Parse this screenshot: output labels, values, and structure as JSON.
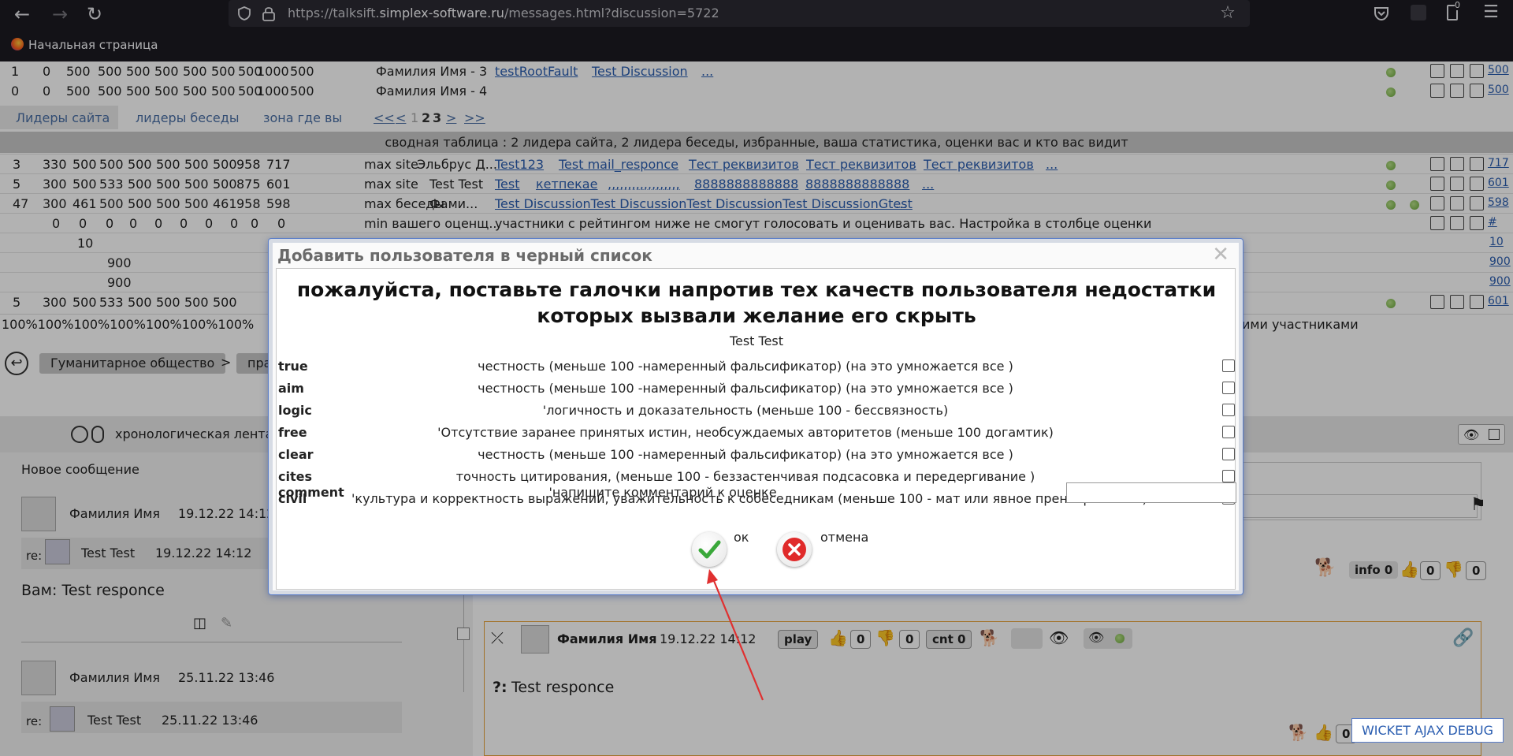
{
  "browser": {
    "url_prefix": "https://talksift.",
    "url_domain": "simplex-software.ru",
    "url_path": "/messages.html?discussion=5722",
    "bookmark": "Начальная страница",
    "downloads_badge": "0"
  },
  "table_top": [
    {
      "nums": [
        "1",
        "0",
        "500",
        "500",
        "500",
        "500",
        "500",
        "500",
        "500",
        "1000",
        "500"
      ],
      "name": "Фамилия Имя - 3",
      "links": [
        "testRootFault",
        "Test Discussion",
        "..."
      ],
      "score": "500"
    },
    {
      "nums": [
        "0",
        "0",
        "500",
        "500",
        "500",
        "500",
        "500",
        "500",
        "500",
        "1000",
        "500"
      ],
      "name": "Фамилия Имя - 4",
      "links": [],
      "score": "500"
    }
  ],
  "tabs": {
    "site_leaders": "Лидеры сайта",
    "chat_leaders": "лидеры беседы",
    "zone": "зона где вы"
  },
  "pager": {
    "first": "<<",
    "prev": "<",
    "p1": "1",
    "p2": "2",
    "p3": "3",
    "next": ">",
    "last": ">>"
  },
  "summary_caption": "сводная таблица : 2 лидера сайта, 2 лидера беседы, избранные, ваша статистика, оценки вас и кто вас видит",
  "table_rows": [
    {
      "nums": [
        "3",
        "330",
        "500",
        "500",
        "500",
        "500",
        "500",
        "500",
        "958",
        "717"
      ],
      "label": "max site",
      "name": "Эльбрус Д...",
      "links": [
        "Test123",
        "Test mail_responce",
        "Тест реквизитов",
        "Тест реквизитов",
        "Тест реквизитов",
        "..."
      ],
      "score": "717"
    },
    {
      "nums": [
        "5",
        "300",
        "500",
        "533",
        "500",
        "500",
        "500",
        "500",
        "875",
        "601"
      ],
      "label": "max site",
      "name": "Test Test",
      "links": [
        "Test",
        "кетпекае",
        ",,,,,,,,,,,,,,,,,,",
        "8888888888888",
        "8888888888888",
        "..."
      ],
      "score": "601"
    },
    {
      "nums": [
        "47",
        "300",
        "461",
        "500",
        "500",
        "500",
        "500",
        "461",
        "958",
        "598"
      ],
      "label": "max беседы",
      "name": "Фами...",
      "links": [
        "Test DiscussionTest DiscussionTest DiscussionTest DiscussionGtest",
        "..."
      ],
      "score": "598"
    },
    {
      "nums": [
        "0",
        "0",
        "0",
        "0",
        "0",
        "0",
        "0",
        "0",
        "0",
        "0"
      ],
      "label": "min вашего оценщ...",
      "text": "участники с рейтингом ниже не смогут голосовать и оценивать вас. Настройка в столбце оценки",
      "score": "#"
    }
  ],
  "extra_rows": [
    {
      "value": "10",
      "score": "10"
    },
    {
      "value": "900",
      "score": "900"
    },
    {
      "value": "900",
      "score": "900"
    }
  ],
  "last_row": {
    "nums": [
      "5",
      "300",
      "500",
      "533",
      "500",
      "500",
      "500",
      "500"
    ],
    "score": "601"
  },
  "percent_row": [
    "100%",
    "100%",
    "100%",
    "100%",
    "100%",
    "100%",
    "100%"
  ],
  "percent_tail": "ими участниками",
  "breadcrumb": {
    "first": "Гуманитарное общество",
    "sep": ">",
    "second": "пра"
  },
  "timeline_label": "хронологическая лента т",
  "sidebar": {
    "new_message": "Новое сообщение",
    "msg1": {
      "author": "Фамилия Имя",
      "date": "19.12.22 14:12"
    },
    "reply1": {
      "re": "re:",
      "author": "Test Test",
      "date": "19.12.22 14:12"
    },
    "text1": "Вам: Test responce",
    "msg2": {
      "author": "Фамилия Имя",
      "date": "25.11.22 13:46"
    },
    "reply2": {
      "re": "re:",
      "author": "Test Test",
      "date": "25.11.22 13:46"
    }
  },
  "right_panel": {
    "info": "info 0",
    "like": "0",
    "dislike": "0"
  },
  "post": {
    "author": "Фамилия Имя",
    "date": "19.12.22 14:12",
    "play": "play",
    "likes": "0",
    "dislikes": "0",
    "cnt": "cnt 0",
    "q_label": "?:",
    "text": "Test responce",
    "bottom_count": "0"
  },
  "dialog": {
    "title": "Добавить пользователя в черный список",
    "heading": "пожалуйста, поставьте галочки напротив тех качеств пользователя недостатки которых вызвали желание его скрыть",
    "user": "Test Test",
    "qualities": [
      {
        "key": "true",
        "desc": "честность (меньше 100 -намеренный фальсификатор) (на это умножается все )"
      },
      {
        "key": "aim",
        "desc": "честность (меньше 100 -намеренный фальсификатор) (на это умножается все )"
      },
      {
        "key": "logic",
        "desc": "'логичность и доказательность (меньше 100 - бессвязность)"
      },
      {
        "key": "free",
        "desc": "'Отсутствие заранее принятых истин, необсуждаемых авторитетов (меньше 100 догамтик)"
      },
      {
        "key": "clear",
        "desc": "честность (меньше 100 -намеренный фальсификатор) (на это умножается все )"
      },
      {
        "key": "cites",
        "desc": "точность цитирования, (меньше 100 - беззастенчивая подсасовка и передергивание )"
      },
      {
        "key": "civil",
        "desc": "'культура и корректность выражений, уважительность к собеседникам (меньше 100 - мат или явное пренебрежение)"
      }
    ],
    "comment_key": "comment",
    "comment_desc": "'напишите комментарий к оценке",
    "comment_value": "",
    "ok": "ок",
    "cancel": "отмена"
  },
  "wicket": "WICKET AJAX DEBUG"
}
